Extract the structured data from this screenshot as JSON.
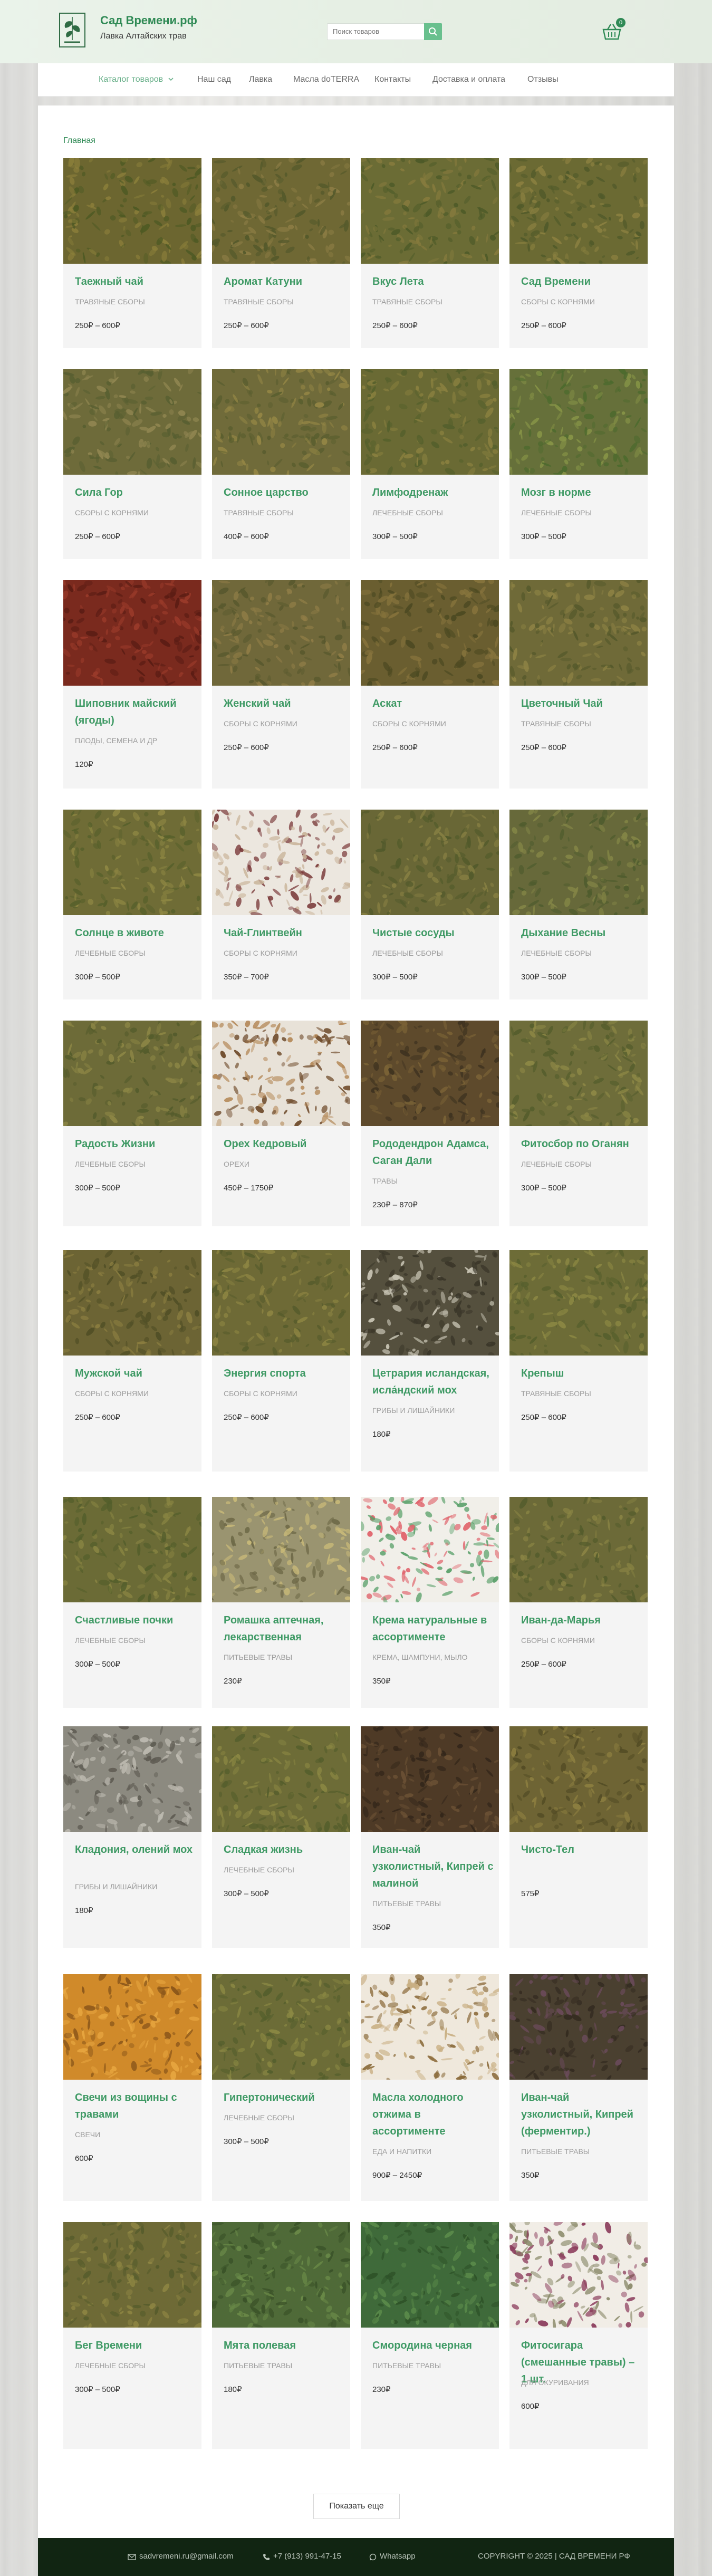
{
  "header": {
    "site_name": "Сад Времени.рф",
    "tagline": "Лавка Алтайских трав",
    "search_placeholder": "Поиск товаров",
    "cart_count": "0"
  },
  "nav": {
    "items": [
      {
        "label": "Каталог товаров",
        "icon": "chevron-down-icon"
      },
      {
        "label": "Наш сад"
      },
      {
        "label": "Лавка"
      },
      {
        "label": "Масла doTERRA"
      },
      {
        "label": "Контакты"
      },
      {
        "label": "Доставка и оплата"
      },
      {
        "label": "Отзывы"
      }
    ]
  },
  "breadcrumb": "Главная",
  "products": [
    {
      "name": "Таежный чай",
      "category": "ТРАВЯНЫЕ СБОРЫ",
      "price": "250₽ – 600₽",
      "swatch": [
        "#6c6630",
        "#8a7e3a",
        "#4f5a24"
      ]
    },
    {
      "name": "Аромат Катуни",
      "category": "ТРАВЯНЫЕ СБОРЫ",
      "price": "250₽ – 600₽",
      "swatch": [
        "#6f6834",
        "#8b7c44",
        "#54592b"
      ]
    },
    {
      "name": "Вкус Лета",
      "category": "ТРАВЯНЫЕ СБОРЫ",
      "price": "250₽ – 600₽",
      "swatch": [
        "#6b6c35",
        "#857a3d",
        "#4d5a28"
      ]
    },
    {
      "name": "Сад Времени",
      "category": "СБОРЫ С КОРНЯМИ",
      "price": "250₽ – 600₽",
      "swatch": [
        "#6b6a33",
        "#8a8040",
        "#515a2a"
      ]
    },
    {
      "name": "Сила Гор",
      "category": "СБОРЫ С КОРНЯМИ",
      "price": "250₽ – 600₽",
      "swatch": [
        "#6e6b3a",
        "#8f8550",
        "#585f31"
      ]
    },
    {
      "name": "Сонное царство",
      "category": "ТРАВЯНЫЕ СБОРЫ",
      "price": "400₽ – 600₽",
      "swatch": [
        "#706b3a",
        "#948645",
        "#5a5e2f"
      ]
    },
    {
      "name": "Лимфодренаж",
      "category": "ЛЕЧЕБНЫЕ СБОРЫ",
      "price": "300₽ – 500₽",
      "swatch": [
        "#6a6a34",
        "#89803f",
        "#55602c"
      ]
    },
    {
      "name": "Мозг в норме",
      "category": "ЛЕЧЕБНЫЕ СБОРЫ",
      "price": "300₽ – 500₽",
      "swatch": [
        "#66703a",
        "#879447",
        "#4d6a2e"
      ]
    },
    {
      "name": "Шиповник майский (ягоды)",
      "category": "ПЛОДЫ, СЕМЕНА И ДР",
      "price": "120₽",
      "swatch": [
        "#7a2a1e",
        "#9a3a2a",
        "#5a1c14"
      ]
    },
    {
      "name": "Женский чай",
      "category": "СБОРЫ С КОРНЯМИ",
      "price": "250₽ – 600₽",
      "swatch": [
        "#70683a",
        "#8e7c46",
        "#59592e"
      ]
    },
    {
      "name": "Аскат",
      "category": "СБОРЫ С КОРНЯМИ",
      "price": "250₽ – 600₽",
      "swatch": [
        "#6a5e30",
        "#86733c",
        "#4d4a22"
      ]
    },
    {
      "name": "Цветочный Чай",
      "category": "ТРАВЯНЫЕ СБОРЫ",
      "price": "250₽ – 600₽",
      "swatch": [
        "#6f6a38",
        "#8d8244",
        "#55592b"
      ]
    },
    {
      "name": "Солнце в животе",
      "category": "ЛЕЧЕБНЫЕ СБОРЫ",
      "price": "300₽ – 500₽",
      "swatch": [
        "#6f6c36",
        "#8e8743",
        "#57602b"
      ]
    },
    {
      "name": "Чай-Глинтвейн",
      "category": "СБОРЫ С КОРНЯМИ",
      "price": "350₽ – 700₽",
      "swatch": [
        "#ece7df",
        "#c9b49a",
        "#7a3a3a"
      ]
    },
    {
      "name": "Чистые сосуды",
      "category": "ЛЕЧЕБНЫЕ СБОРЫ",
      "price": "300₽ – 500₽",
      "swatch": [
        "#696736",
        "#857e42",
        "#525a2b"
      ]
    },
    {
      "name": "Дыхание Весны",
      "category": "ЛЕЧЕБНЫЕ СБОРЫ",
      "price": "300₽ – 500₽",
      "swatch": [
        "#67693a",
        "#838546",
        "#4f5c2e"
      ]
    },
    {
      "name": "Радость Жизни",
      "category": "ЛЕЧЕБНЫЕ СБОРЫ",
      "price": "300₽ – 500₽",
      "swatch": [
        "#6d6b38",
        "#8c8645",
        "#555c2c"
      ]
    },
    {
      "name": "Орех Кедровый",
      "category": "ОРЕХИ",
      "price": "450₽ – 1750₽",
      "swatch": [
        "#e8e2d8",
        "#b58a5a",
        "#6e4a2a"
      ]
    },
    {
      "name": "Рододендрон Адамса, Саган Дали",
      "category": "ТРАВЫ",
      "price": "230₽ – 870₽",
      "swatch": [
        "#5e4a2c",
        "#7a6236",
        "#3f3320"
      ]
    },
    {
      "name": "Фитосбор по Оганян",
      "category": "ЛЕЧЕБНЫЕ СБОРЫ",
      "price": "300₽ – 500₽",
      "swatch": [
        "#6e6d3a",
        "#8d8846",
        "#565e2d"
      ]
    },
    {
      "name": "Мужской чай",
      "category": "СБОРЫ С КОРНЯМИ",
      "price": "250₽ – 600₽",
      "swatch": [
        "#6c6434",
        "#8a7d40",
        "#514f26"
      ]
    },
    {
      "name": "Энергия спорта",
      "category": "СБОРЫ С КОРНЯМИ",
      "price": "250₽ – 600₽",
      "swatch": [
        "#6e6a36",
        "#8c8442",
        "#575c2c"
      ]
    },
    {
      "name": "Цетрария исландская, исла́ндский мох",
      "category": "ГРИБЫ И ЛИШАЙНИКИ",
      "price": "180₽",
      "swatch": [
        "#55503e",
        "#c8c4b4",
        "#3a3629"
      ]
    },
    {
      "name": "Крепыш",
      "category": "ТРАВЯНЫЕ СБОРЫ",
      "price": "250₽ – 600₽",
      "swatch": [
        "#6d6c37",
        "#8b8743",
        "#555e2c"
      ]
    },
    {
      "name": "Счастливые почки",
      "category": "ЛЕЧЕБНЫЕ СБОРЫ",
      "price": "300₽ – 500₽",
      "swatch": [
        "#6b6b36",
        "#888442",
        "#535e2b"
      ]
    },
    {
      "name": "Ромашка аптечная, лекарственная",
      "category": "ПИТЬЕВЫЕ ТРАВЫ",
      "price": "230₽",
      "swatch": [
        "#9a9470",
        "#c8b978",
        "#6f6a48"
      ]
    },
    {
      "name": "Крема натуральные в ассортименте",
      "category": "КРЕМА, ШАМПУНИ, МЫЛО",
      "price": "350₽",
      "swatch": [
        "#f1efe9",
        "#e0636b",
        "#5aa06a"
      ]
    },
    {
      "name": "Иван-да-Марья",
      "category": "СБОРЫ С КОРНЯМИ",
      "price": "250₽ – 600₽",
      "swatch": [
        "#6c6a38",
        "#8a8444",
        "#545c2c"
      ]
    },
    {
      "name": "Кладония, олений мох",
      "category": "ГРИБЫ И ЛИШАЙНИКИ",
      "price": "180₽",
      "swatch": [
        "#8c8a80",
        "#bdbab0",
        "#5e5b52"
      ]
    },
    {
      "name": "Сладкая жизнь",
      "category": "ЛЕЧЕБНЫЕ СБОРЫ",
      "price": "300₽ – 500₽",
      "swatch": [
        "#6d6c37",
        "#8b8743",
        "#555e2c"
      ]
    },
    {
      "name": "Иван-чай узколистный, Кипрей с малиной",
      "category": "ПИТЬЕВЫЕ ТРАВЫ",
      "price": "350₽",
      "swatch": [
        "#4e3a26",
        "#6a5034",
        "#33261a"
      ]
    },
    {
      "name": "Чисто-Тел",
      "category": "",
      "price": "575₽",
      "swatch": [
        "#6e6434",
        "#8c7e40",
        "#534c25"
      ]
    },
    {
      "name": "Свечи из вощины с травами",
      "category": "СВЕЧИ",
      "price": "600₽",
      "swatch": [
        "#d08a2a",
        "#e7a640",
        "#8a561a"
      ]
    },
    {
      "name": "Гипертонический",
      "category": "ЛЕЧЕБНЫЕ СБОРЫ",
      "price": "300₽ – 500₽",
      "swatch": [
        "#6c6c37",
        "#8a8843",
        "#545e2c"
      ]
    },
    {
      "name": "Масла холодного отжима в ассортименте",
      "category": "ЕДА И НАПИТКИ",
      "price": "900₽ – 2450₽",
      "swatch": [
        "#efe8dc",
        "#c8ae82",
        "#8a6a3a"
      ]
    },
    {
      "name": "Иван-чай узколистный, Кипрей (ферментир.)",
      "category": "ПИТЬЕВЫЕ ТРАВЫ",
      "price": "350₽",
      "swatch": [
        "#4a4030",
        "#6a4a5a",
        "#332a20"
      ]
    },
    {
      "name": "Бег Времени",
      "category": "ЛЕЧЕБНЫЕ СБОРЫ",
      "price": "300₽ – 500₽",
      "swatch": [
        "#6e6a36",
        "#8c8442",
        "#565c2c"
      ]
    },
    {
      "name": "Мята полевая",
      "category": "ПИТЬЕВЫЕ ТРАВЫ",
      "price": "180₽",
      "swatch": [
        "#4f6a38",
        "#6a8a48",
        "#3a5228"
      ]
    },
    {
      "name": "Смородина черная",
      "category": "ПИТЬЕВЫЕ ТРАВЫ",
      "price": "230₽",
      "swatch": [
        "#3f6a3a",
        "#5a8a4a",
        "#2e5228"
      ]
    },
    {
      "name": "Фитосигара (смешанные травы) – 1 шт.",
      "category": "ДЛЯ ОКУРИВАНИЯ",
      "price": "600₽",
      "swatch": [
        "#f1ede6",
        "#8a8a6a",
        "#8a3a5a"
      ]
    }
  ],
  "load_more_label": "Показать еще",
  "footer": {
    "email": "sadvremeni.ru@gmail.com",
    "phone": "+7 (913) 991-47-15",
    "whatsapp": "Whatsapp",
    "copyright": "COPYRIGHT © 2025 | САД ВРЕМЕНИ РФ"
  }
}
